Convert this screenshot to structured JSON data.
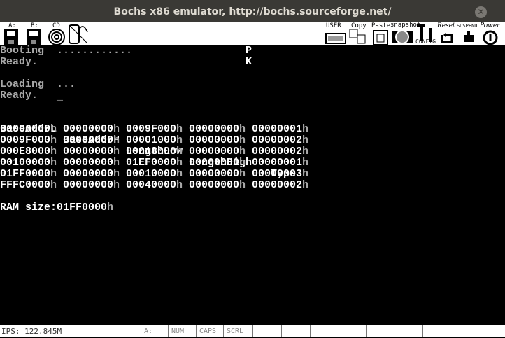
{
  "window": {
    "title": "Bochs x86 emulator, http://bochs.sourceforge.net/",
    "close_icon": "close-icon"
  },
  "toolbar": {
    "floppy_a": "A:",
    "floppy_b": "B:",
    "cdrom": "CD",
    "user": "USER",
    "copy": "Copy",
    "paste": "Paste",
    "snapshot": "snapshot",
    "config": "CONFIG",
    "reset": "Reset",
    "suspend": "SUSPEND",
    "power": "Power"
  },
  "console": {
    "booting": "Booting  ............",
    "booting_flag": "P",
    "ready1": "Ready.",
    "ready1_flag": "K",
    "loading": "Loading  ...",
    "ready2": "Ready.",
    "cursor": "_",
    "headers": [
      "BaseAddrL",
      "BaseAddrH",
      "LengthLow",
      "LengthHigh",
      "Type"
    ],
    "rows": [
      [
        "00000000",
        "00000000",
        "0009F000",
        "00000000",
        "00000001"
      ],
      [
        "0009F000",
        "00000000",
        "00001000",
        "00000000",
        "00000002"
      ],
      [
        "000E8000",
        "00000000",
        "00018000",
        "00000000",
        "00000002"
      ],
      [
        "00100000",
        "00000000",
        "01EF0000",
        "00000000",
        "00000001"
      ],
      [
        "01FF0000",
        "00000000",
        "00010000",
        "00000000",
        "00000003"
      ],
      [
        "FFFC0000",
        "00000000",
        "00040000",
        "00000000",
        "00000002"
      ]
    ],
    "hex_suffix": "h",
    "ram_label": "RAM size:",
    "ram_value": "01FF0000"
  },
  "statusbar": {
    "ips": "IPS: 122.845M",
    "drive": "A:",
    "num": "NUM",
    "caps": "CAPS",
    "scrl": "SCRL"
  },
  "colors": {
    "text_dim": "#a8a8a8",
    "text_bright": "#ffffff",
    "background": "#000000"
  }
}
